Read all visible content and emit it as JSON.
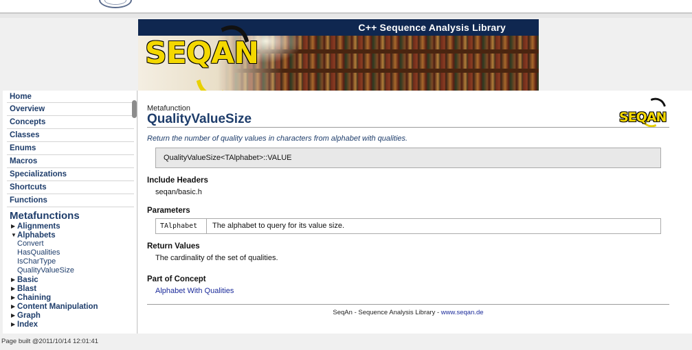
{
  "banner": {
    "subtitle": "C++ Sequence Analysis Library",
    "logo_text": "SEQAN"
  },
  "sidebar": {
    "nav": [
      "Home",
      "Overview",
      "Concepts",
      "Classes",
      "Enums",
      "Macros",
      "Specializations",
      "Shortcuts",
      "Functions"
    ],
    "heading": "Metafunctions",
    "tree_before": [
      {
        "label": "Alignments",
        "expanded": false
      },
      {
        "label": "Alphabets",
        "expanded": true
      }
    ],
    "alphabets_children": [
      "Convert",
      "HasQualities",
      "IsCharType",
      "QualityValueSize"
    ],
    "tree_after": [
      {
        "label": "Basic",
        "expanded": false
      },
      {
        "label": "Blast",
        "expanded": false
      },
      {
        "label": "Chaining",
        "expanded": false
      },
      {
        "label": "Content Manipulation",
        "expanded": false
      },
      {
        "label": "Graph",
        "expanded": false
      },
      {
        "label": "Index",
        "expanded": false
      }
    ]
  },
  "content": {
    "kind": "Metafunction",
    "title": "QualityValueSize",
    "logo_text": "SEQAN",
    "summary": "Return the number of quality values in characters from alphabet with qualities.",
    "signature": "QualityValueSize<TAlphabet>::VALUE",
    "include_heading": "Include Headers",
    "include_value": "seqan/basic.h",
    "params_heading": "Parameters",
    "param_name": "TAlphabet",
    "param_desc": "The alphabet to query for its value size.",
    "return_heading": "Return Values",
    "return_value": "The cardinality of the set of qualities.",
    "concept_heading": "Part of Concept",
    "concept_link": "Alphabet With Qualities",
    "footer_text": "SeqAn - Sequence Analysis Library - ",
    "footer_link": "www.seqan.de"
  },
  "build_info": "Page built @2011/10/14 12:01:41",
  "colors": {
    "banner_bar": "#0f2750",
    "link": "#1a2a9a",
    "heading": "#1e3d6b",
    "logo_yellow": "#f4d800"
  }
}
